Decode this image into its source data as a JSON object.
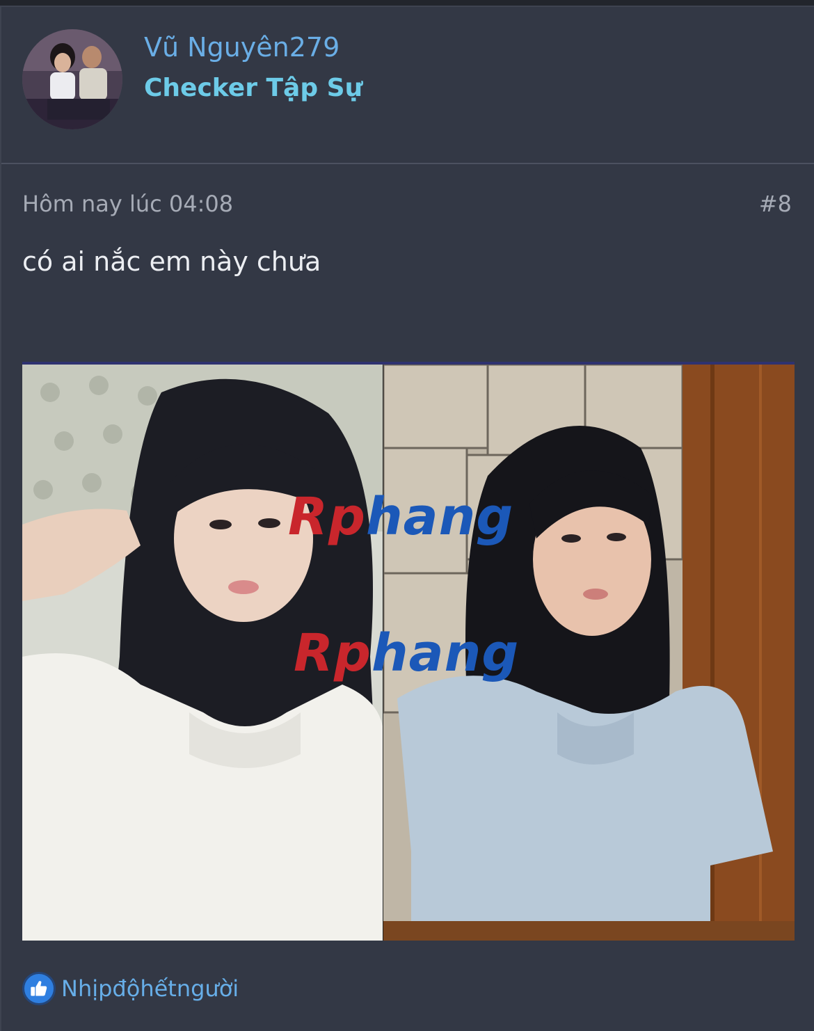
{
  "author": {
    "username": "Vũ Nguyên279",
    "title": "Checker Tập Sự"
  },
  "post": {
    "date": "Hôm nay lúc 04:08",
    "number": "#8",
    "text": "có ai nắc em này chưa"
  },
  "attachment": {
    "watermark": [
      "Rp",
      "hang"
    ]
  },
  "reactions": {
    "icon": "like-icon",
    "names": "Nhịpđộhếtngười"
  },
  "colors": {
    "card_background": "#333845",
    "username": "#6aaee6",
    "user_title": "#6dcbe8",
    "reaction_link": "#67aee8",
    "watermark_red": "#c9262c",
    "watermark_blue": "#1b58b8"
  }
}
